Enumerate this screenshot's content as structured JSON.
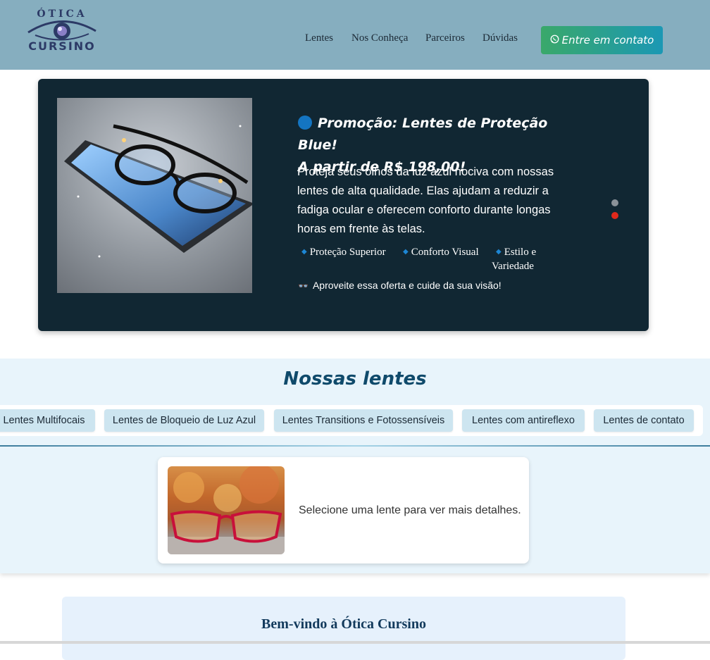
{
  "header": {
    "logo_top": "ÓTICA",
    "logo_bottom": "CURSINO",
    "nav": [
      "Lentes",
      "Nos Conheça",
      "Parceiros",
      "Dúvidas"
    ],
    "cta_label": "Entre em contato",
    "colors": {
      "header_bg": "#86aebf",
      "cta_start": "#3aa86a",
      "cta_end": "#1b98b4"
    }
  },
  "hero": {
    "title_line1": "Promoção: Lentes de Proteção Blue!",
    "title_line2": "A partir de R$ 198,00!",
    "description": "Proteja seus olhos da luz azul nociva com nossas lentes de alta qualidade. Elas ajudam a reduzir a fadiga ocular e oferecem conforto durante longas horas em frente às telas.",
    "features": [
      "Proteção Superior",
      "Conforto Visual",
      "Estilo e Variedade"
    ],
    "note": "Aproveite essa oferta e cuide da sua visão!",
    "image_icon": "glasses-on-phone-image",
    "slides": {
      "count": 2,
      "active": 2
    },
    "colors": {
      "bg": "#112733",
      "dot_active": "#e0291c",
      "dot_inactive": "#8a9299"
    }
  },
  "lenses": {
    "title": "Nossas lentes",
    "tabs": [
      "Lentes Multifocais",
      "Lentes de Bloqueio de Luz Azul",
      "Lentes Transitions e Fotossensíveis",
      "Lentes com antireflexo",
      "Lentes de contato"
    ],
    "detail_text": "Selecione uma lente para ver mais detalhes."
  },
  "welcome": {
    "title": "Bem-vindo à Ótica Cursino"
  }
}
